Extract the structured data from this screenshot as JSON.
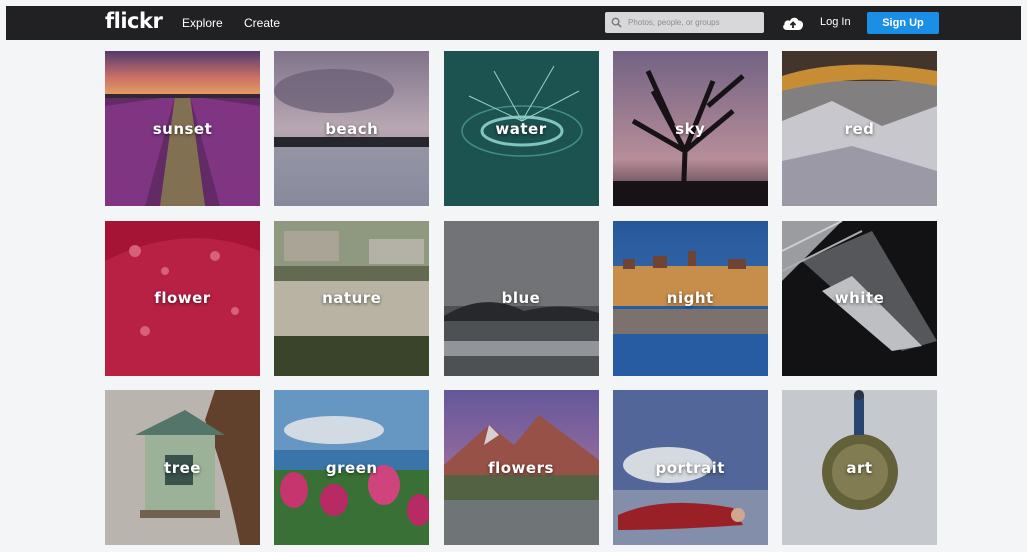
{
  "header": {
    "logo": "flickr",
    "nav": [
      {
        "label": "Explore"
      },
      {
        "label": "Create"
      }
    ],
    "search_placeholder": "Photos, people, or groups",
    "login_label": "Log In",
    "signup_label": "Sign Up"
  },
  "tiles": [
    {
      "label": "sunset"
    },
    {
      "label": "beach"
    },
    {
      "label": "water"
    },
    {
      "label": "sky"
    },
    {
      "label": "red"
    },
    {
      "label": "flower"
    },
    {
      "label": "nature"
    },
    {
      "label": "blue"
    },
    {
      "label": "night"
    },
    {
      "label": "white"
    },
    {
      "label": "tree"
    },
    {
      "label": "green"
    },
    {
      "label": "flowers"
    },
    {
      "label": "portrait"
    },
    {
      "label": "art"
    }
  ]
}
